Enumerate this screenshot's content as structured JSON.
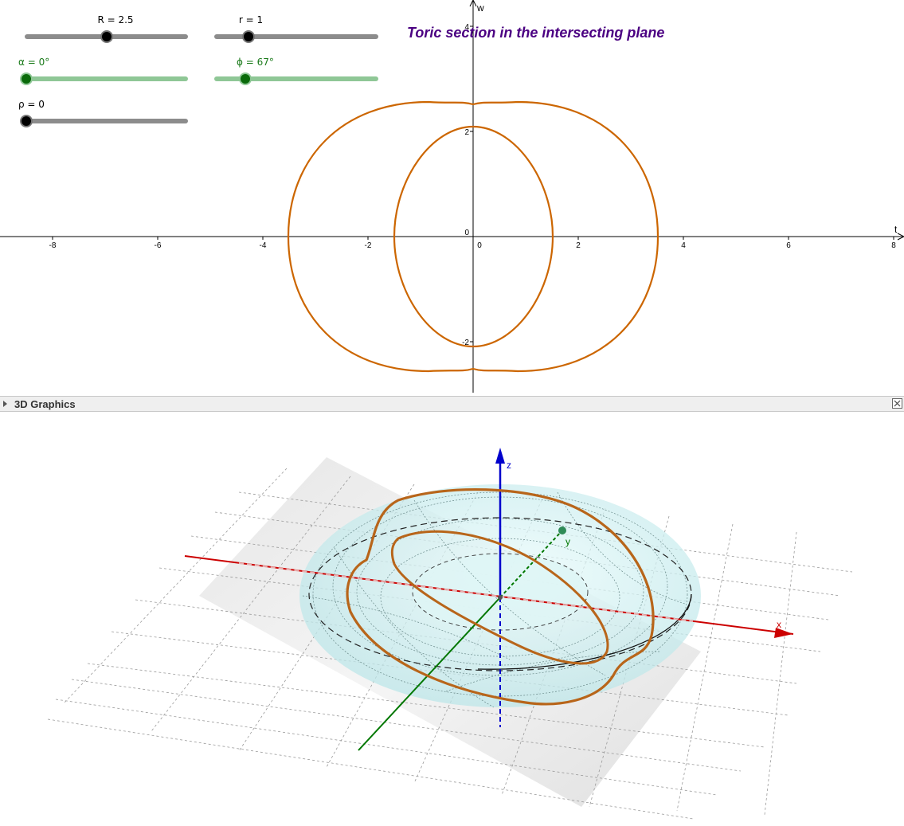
{
  "graphics2d": {
    "title": "Toric section in the intersecting plane",
    "axis_x_label": "t",
    "axis_y_label": "w",
    "x_ticks": [
      "-8",
      "-6",
      "-4",
      "-2",
      "0",
      "2",
      "4",
      "6",
      "8"
    ],
    "y_ticks": [
      "-2",
      "0",
      "2",
      "4"
    ],
    "curve_color": "#cc6600"
  },
  "sliders": [
    {
      "id": "R",
      "label": "R = 2.5",
      "color": "#8c8c8c",
      "fraction": 0.5
    },
    {
      "id": "r",
      "label": "r = 1",
      "color": "#8c8c8c",
      "fraction": 0.2
    },
    {
      "id": "alpha",
      "label": "α = 0°",
      "color": "#8fc796",
      "fraction": 0.0
    },
    {
      "id": "phi",
      "label": "ϕ = 67°",
      "color": "#8fc796",
      "fraction": 0.19
    },
    {
      "id": "rho",
      "label": "ρ = 0",
      "color": "#8c8c8c",
      "fraction": 0.0
    }
  ],
  "panel3d": {
    "title": "3D Graphics",
    "axis_x_label": "x",
    "axis_y_label": "y",
    "axis_z_label": "z",
    "x_axis_color": "#cc0000",
    "y_axis_color": "#007700",
    "z_axis_color": "#0000cc",
    "torus_color": "#bfeeee",
    "section_color": "#cc6600"
  },
  "icons": {
    "collapse": "triangle-right-icon",
    "close": "close-icon"
  }
}
